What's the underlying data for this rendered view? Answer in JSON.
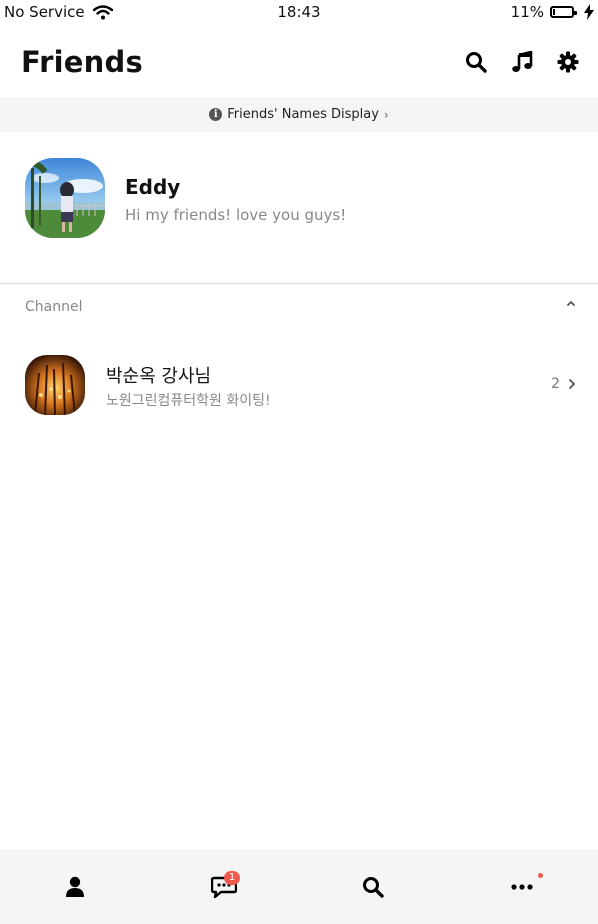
{
  "status_bar": {
    "carrier": "No Service",
    "time": "18:43",
    "battery": "11%",
    "battery_level": 0.11,
    "icons": [
      "wifi-icon",
      "battery-icon",
      "charging-bolt-icon"
    ]
  },
  "header": {
    "title": "Friends",
    "icons": [
      "search-icon",
      "music-note-icon",
      "gear-icon"
    ]
  },
  "banner": {
    "text": "Friends' Names Display",
    "chevron": "›"
  },
  "profile": {
    "name": "Eddy",
    "status_message": "Hi my friends! love you guys!"
  },
  "channel_section": {
    "label": "Channel",
    "items": [
      {
        "name": "박순옥 강사님",
        "message": "노원그린컴퓨터학원 화이팅!",
        "count": "2"
      }
    ]
  },
  "bottom_nav": {
    "items": [
      {
        "icon": "person-icon",
        "badge": ""
      },
      {
        "icon": "chat-bubble-icon",
        "badge": "1"
      },
      {
        "icon": "search-icon",
        "badge": ""
      },
      {
        "icon": "more-dots-icon",
        "badge": ""
      }
    ]
  },
  "colors": {
    "badge": "#f05a4a",
    "banner_bg": "#f5f5f5",
    "nav_bg": "#f5f5f5",
    "secondary_text": "#888888"
  }
}
